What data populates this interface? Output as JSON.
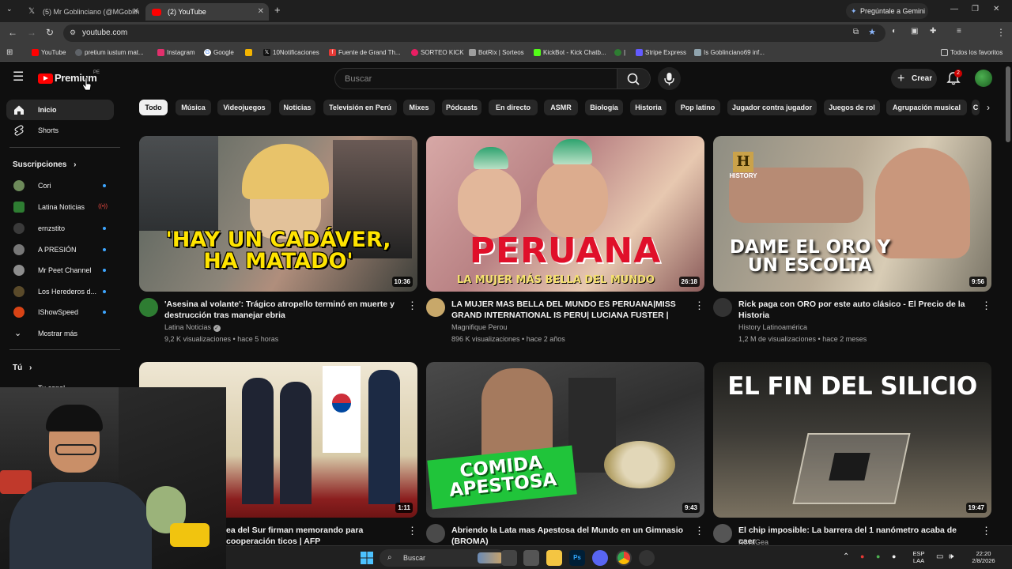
{
  "browser": {
    "tabs": [
      {
        "label": "(5) Mr Goblinciano (@MGoblin",
        "icon": "x-logo-icon",
        "active": false
      },
      {
        "label": "(2) YouTube",
        "icon": "youtube-icon",
        "active": true
      }
    ],
    "gemini_label": "Pregúntale a Gemini",
    "url": "youtube.com",
    "bookmarks": [
      {
        "label": "YouTube",
        "color": "#ff0000"
      },
      {
        "label": "pretium iustum mat...",
        "color": "#5f6368"
      },
      {
        "label": "Instagram",
        "color": "#e1306c"
      },
      {
        "label": "Google",
        "color": "#4285f4"
      },
      {
        "label": "",
        "color": "#f4b400"
      },
      {
        "label": "10Notificaciones",
        "color": "#111111"
      },
      {
        "label": "Fuente de Grand Th...",
        "color": "#e53935"
      },
      {
        "label": "SORTEO KICK",
        "color": "#e91e63"
      },
      {
        "label": "BotRix | Sorteos",
        "color": "#9e9e9e"
      },
      {
        "label": "KickBot - Kick Chatb...",
        "color": "#53fc18"
      },
      {
        "label": "|",
        "color": "#2e7d32"
      },
      {
        "label": "Stripe Express",
        "color": "#635bff"
      },
      {
        "label": "Is Goblinciano69 inf...",
        "color": "#90a4ae"
      }
    ],
    "all_favorites": "Todos los favoritos"
  },
  "header": {
    "logo_text": "Premium",
    "country_code": "PE",
    "search_placeholder": "Buscar",
    "create_label": "Crear",
    "notification_count": "2"
  },
  "sidebar": {
    "main": [
      {
        "label": "Inicio",
        "icon": "home-icon",
        "active": true
      },
      {
        "label": "Shorts",
        "icon": "shorts-icon",
        "active": false
      }
    ],
    "subscriptions_title": "Suscripciones",
    "subscriptions": [
      {
        "label": "Cori",
        "color": "#6d8a5a",
        "indicator": "dot"
      },
      {
        "label": "Latina Noticias",
        "color": "#2e7d32",
        "indicator": "live"
      },
      {
        "label": "ernzstito",
        "color": "#3a3a3a",
        "indicator": "dot"
      },
      {
        "label": "A PRESIÓN",
        "color": "#777777",
        "indicator": "dot"
      },
      {
        "label": "Mr Peet Channel",
        "color": "#8d8d8d",
        "indicator": "dot"
      },
      {
        "label": "Los Herederos d...",
        "color": "#5a4a2a",
        "indicator": "dot"
      },
      {
        "label": "IShowSpeed",
        "color": "#d84315",
        "indicator": "dot"
      }
    ],
    "show_more": "Mostrar más",
    "you_title": "Tú",
    "your_channel": "Tu canal"
  },
  "chips": [
    "Todo",
    "Música",
    "Videojuegos",
    "Noticias",
    "Televisión en Perú",
    "Mixes",
    "Pódcasts",
    "En directo",
    "ASMR",
    "Biología",
    "Historia",
    "Pop latino",
    "Jugador contra jugador",
    "Juegos de rol",
    "Agrupación musical",
    "C"
  ],
  "videos": [
    {
      "title": "'Asesina al volante': Trágico atropello terminó en muerte y destrucción tras manejar ebria",
      "channel": "Latina Noticias",
      "verified": true,
      "meta": "9,2 K visualizaciones • hace 5 horas",
      "duration": "10:36",
      "overlay": "'HAY UN CADÁVER, HA MATADO'",
      "overlay_color": "#ffe400",
      "thumb_colors": [
        "#6c6f6a",
        "#9a8d80",
        "#3f4a3f"
      ],
      "avatar_color": "#2e7d32"
    },
    {
      "title": "LA MUJER MAS BELLA DEL MUNDO ES PERUANA|MISS GRAND INTERNATIONAL IS PERU| LUCIANA FUSTER | FULL ...",
      "channel": "Magnifique Perou",
      "verified": false,
      "meta": "896 K visualizaciones • hace 2 años",
      "duration": "26:18",
      "overlay": "PERUANA",
      "overlay_sub": "LA MUJER MÁS BELLA DEL MUNDO",
      "overlay_color": "#e0102a",
      "thumb_colors": [
        "#c99aa0",
        "#b07a7a",
        "#d8b9a6"
      ],
      "avatar_color": "#c8a86a"
    },
    {
      "title": "Rick paga con ORO por este auto clásico - El Precio de la Historia",
      "channel": "History Latinoamérica",
      "verified": false,
      "meta": "1,2 M de visualizaciones • hace 2 meses",
      "duration": "9:56",
      "overlay": "DAME EL ORO Y UN ESCOLTA",
      "overlay_color": "#ffffff",
      "thumb_colors": [
        "#9b9a8c",
        "#c4b8a2",
        "#6e6a5e"
      ],
      "avatar_color": "#333333",
      "brand": "HISTORY"
    },
    {
      "title": "ea del Sur firman memorando para cooperación ticos | AFP",
      "channel": "",
      "verified": false,
      "meta": "",
      "duration": "1:11",
      "overlay": "",
      "overlay_color": "#ffffff",
      "thumb_colors": [
        "#e6ddc8",
        "#8b1f1f",
        "#c9b488"
      ],
      "avatar_color": "#1a1a1a"
    },
    {
      "title": "Abriendo la Lata mas Apestosa del Mundo en un Gimnasio (BROMA)",
      "channel": "",
      "verified": false,
      "meta": "",
      "duration": "9:43",
      "overlay": "COMIDA APESTOSA",
      "overlay_color": "#ffffff",
      "thumb_colors": [
        "#3a3a3a",
        "#6b6b6b",
        "#242424"
      ],
      "avatar_color": "#4a4a4a"
    },
    {
      "title": "El chip imposible: La barrera del 1 nanómetro acaba de caer",
      "channel": "NovaGea",
      "verified": false,
      "meta": "",
      "duration": "19:47",
      "overlay": "EL FIN DEL SILICIO",
      "overlay_color": "#ffffff",
      "thumb_colors": [
        "#2a2a28",
        "#4c4a45",
        "#6d675a"
      ],
      "avatar_color": "#555555"
    }
  ],
  "taskbar": {
    "search_label": "Buscar",
    "lang_top": "ESP",
    "lang_bottom": "LAA",
    "time": "22:20",
    "date": "2/8/2026"
  }
}
